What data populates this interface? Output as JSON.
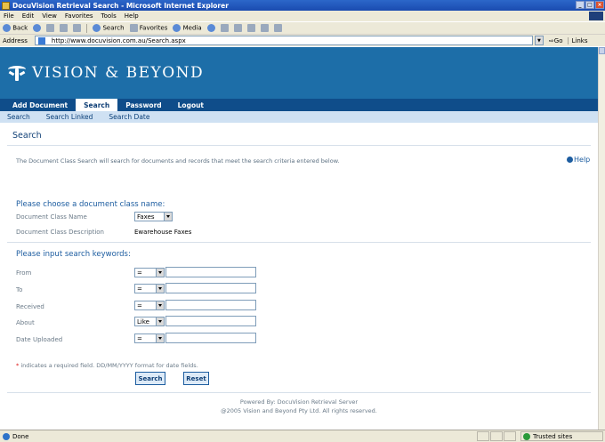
{
  "window": {
    "title": "DocuVision Retrieval Search - Microsoft Internet Explorer",
    "controls": [
      "_",
      "2",
      "x"
    ]
  },
  "menu": [
    "File",
    "Edit",
    "View",
    "Favorites",
    "Tools",
    "Help"
  ],
  "toolbar": {
    "back": "Back",
    "search": "Search",
    "favorites": "Favorites",
    "media": "Media"
  },
  "address": {
    "label": "Address",
    "url": "http://www.docuvision.com.au/Search.aspx",
    "go": "Go",
    "links": "Links"
  },
  "brand": {
    "name": "VISION & BEYOND",
    "bg_color": "#1d6ea8"
  },
  "nav": {
    "items": [
      "Add Document",
      "Search",
      "Password",
      "Logout"
    ],
    "active": "Search"
  },
  "subnav": [
    "Search",
    "Search Linked",
    "Search Date"
  ],
  "page": {
    "heading": "Search",
    "intro": "The Document Class Search will search for documents and records that meet the search criteria entered below.",
    "help": "Help"
  },
  "doc_class": {
    "section_title": "Please choose a document class name:",
    "name_label": "Document Class Name",
    "name_value": "Faxes",
    "desc_label": "Document Class Description",
    "desc_value": "Ewarehouse Faxes"
  },
  "keywords": {
    "section_title": "Please input search keywords:",
    "rows": [
      {
        "label": "From",
        "operator": "=",
        "value": ""
      },
      {
        "label": "To",
        "operator": "=",
        "value": ""
      },
      {
        "label": "Received",
        "operator": "=",
        "value": ""
      },
      {
        "label": "About",
        "operator": "Like",
        "value": ""
      },
      {
        "label": "Date Uploaded",
        "operator": "=",
        "value": ""
      }
    ]
  },
  "note": {
    "star": "*",
    "text": "indicates a required field. DD/MM/YYYY format for date fields."
  },
  "buttons": {
    "search": "Search",
    "reset": "Reset"
  },
  "footer": {
    "line1": "Powered By: DocuVision Retrieval Server",
    "line2": "@2005 Vision and Beyond Pty Ltd. All rights reserved."
  },
  "status": {
    "text": "Done",
    "zone": "Trusted sites"
  }
}
